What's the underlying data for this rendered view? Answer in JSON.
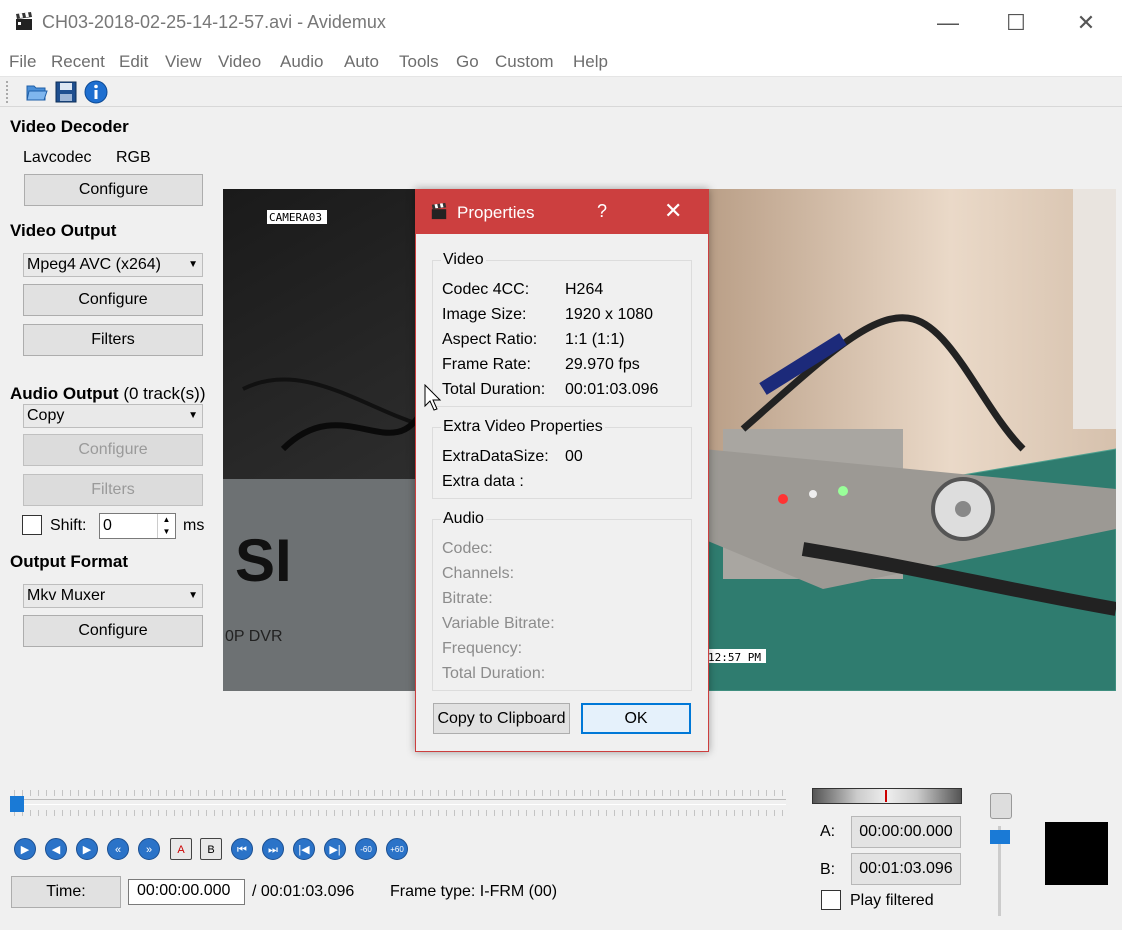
{
  "window": {
    "title": "CH03-2018-02-25-14-12-57.avi - Avidemux",
    "minimize": "—",
    "maximize": "☐",
    "close": "✕"
  },
  "menu": [
    "File",
    "Recent",
    "Edit",
    "View",
    "Video",
    "Audio",
    "Auto",
    "Tools",
    "Go",
    "Custom",
    "Help"
  ],
  "toolbar": {
    "icons": [
      "open-folder-icon",
      "save-floppy-icon",
      "info-icon"
    ]
  },
  "left": {
    "video_decoder_title": "Video Decoder",
    "decoder_name": "Lavcodec",
    "decoder_colorspace": "RGB",
    "decoder_configure": "Configure",
    "video_output_title": "Video Output",
    "video_output_value": "Mpeg4 AVC (x264)",
    "video_output_configure": "Configure",
    "video_output_filters": "Filters",
    "audio_output_title": "Audio Output",
    "audio_output_tracks": "(0 track(s))",
    "audio_output_value": "Copy",
    "audio_output_configure": "Configure",
    "audio_output_filters": "Filters",
    "shift_label": "Shift:",
    "shift_value": "0",
    "shift_unit": "ms",
    "output_format_title": "Output Format",
    "output_format_value": "Mkv Muxer",
    "output_format_configure": "Configure"
  },
  "video_overlay": {
    "camera_label": "CAMERA03",
    "time_stamp": "12:57 PM",
    "brand_text": "SI",
    "dvr_text": "0P DVR"
  },
  "dialog": {
    "title": "Properties",
    "help": "?",
    "close": "✕",
    "video_group": "Video",
    "video_rows": [
      {
        "k": "Codec 4CC:",
        "v": "H264"
      },
      {
        "k": "Image Size:",
        "v": "1920 x 1080"
      },
      {
        "k": "Aspect Ratio:",
        "v": "1:1 (1:1)"
      },
      {
        "k": "Frame Rate:",
        "v": "29.970 fps"
      },
      {
        "k": "Total Duration:",
        "v": "00:01:03.096"
      }
    ],
    "extra_group": "Extra Video Properties",
    "extra_rows": [
      {
        "k": "ExtraDataSize:",
        "v": "00"
      },
      {
        "k": "Extra data :",
        "v": ""
      }
    ],
    "audio_group": "Audio",
    "audio_rows": [
      "Codec:",
      "Channels:",
      "Bitrate:",
      "Variable Bitrate:",
      "Frequency:",
      "Total Duration:"
    ],
    "copy_button": "Copy to Clipboard",
    "ok_button": "OK"
  },
  "bottom": {
    "time_button": "Time:",
    "time_value": "00:00:00.000",
    "total_time": "/ 00:01:03.096",
    "frame_type": "Frame type: I-FRM (00)",
    "a_label": "A:",
    "a_value": "00:00:00.000",
    "b_label": "B:",
    "b_value": "00:01:03.096",
    "play_filtered": "Play filtered",
    "controls": [
      "▶",
      "◀",
      "▶",
      "«",
      "»",
      "A",
      "B",
      "⏮",
      "⏭",
      "|◀",
      "▶|",
      "-60",
      "+60"
    ]
  },
  "slider_position": 0.0
}
